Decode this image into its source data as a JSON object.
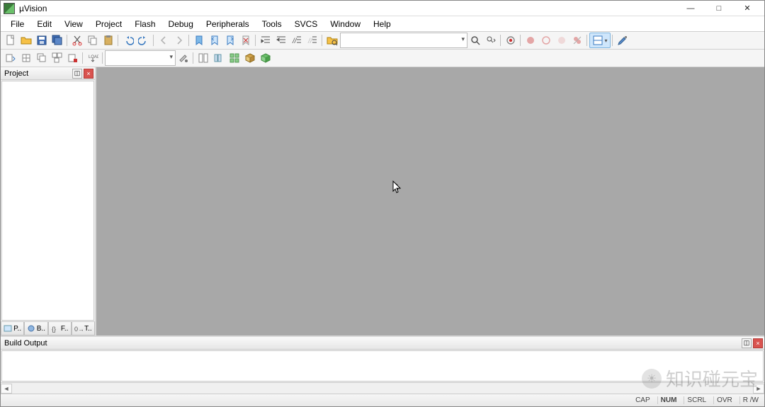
{
  "window": {
    "title": "µVision"
  },
  "menus": [
    "File",
    "Edit",
    "View",
    "Project",
    "Flash",
    "Debug",
    "Peripherals",
    "Tools",
    "SVCS",
    "Window",
    "Help"
  ],
  "toolbar1": {
    "groups": [
      [
        "new",
        "open",
        "save",
        "save-all"
      ],
      [
        "cut",
        "copy",
        "paste"
      ],
      [
        "undo",
        "redo"
      ],
      [
        "nav-back",
        "nav-forward"
      ],
      [
        "bookmark-toggle",
        "bookmark-prev",
        "bookmark-next",
        "bookmark-clear"
      ],
      [
        "indent",
        "outdent",
        "comment",
        "uncomment"
      ],
      [
        "find-in-files"
      ]
    ],
    "find_combo": "",
    "groups2": [
      [
        "find",
        "find-next"
      ],
      [
        "debug-start"
      ],
      [
        "breakpoint-insert",
        "breakpoint-enable",
        "breakpoint-disable",
        "breakpoint-killall"
      ],
      [
        "window-split"
      ]
    ],
    "config_btn": "configure"
  },
  "toolbar2": {
    "build_buttons": [
      "translate",
      "build",
      "rebuild",
      "batch-build",
      "stop-build",
      "download"
    ],
    "target_combo": "",
    "target_buttons": [
      "target-options"
    ],
    "manage_buttons": [
      "file-ext",
      "manage-books",
      "manage-components",
      "select-packs",
      "install-packs"
    ]
  },
  "project_panel": {
    "title": "Project",
    "tabs": [
      {
        "label": "P..",
        "icon": "project"
      },
      {
        "label": "B..",
        "icon": "books"
      },
      {
        "label": "F..",
        "icon": "functions"
      },
      {
        "label": "T..",
        "icon": "templates"
      }
    ]
  },
  "build_output": {
    "title": "Build Output",
    "text": ""
  },
  "statusbar": {
    "cells": [
      "CAP",
      "NUM",
      "SCRL",
      "OVR",
      "R /W"
    ]
  },
  "watermark": "知识碰元宝"
}
